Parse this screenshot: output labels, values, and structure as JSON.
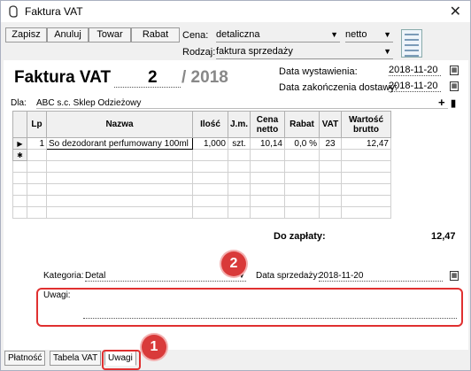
{
  "window": {
    "title": "Faktura VAT",
    "close_glyph": "✕"
  },
  "toolbar": {
    "save": "Zapisz",
    "cancel": "Anuluj",
    "goods": "Towar",
    "discount": "Rabat",
    "price_label": "Cena:",
    "price_value": "detaliczna",
    "netto_value": "netto",
    "type_label": "Rodzaj:",
    "type_value": "faktura sprzedaży"
  },
  "invoice": {
    "title": "Faktura VAT",
    "number": "2",
    "year": "/ 2018",
    "issue_label": "Data wystawienia:",
    "issue_date": "2018-11-20",
    "delivery_label": "Data zakończenia dostawy:",
    "delivery_date": "2018-11-20",
    "for_label": "Dla:",
    "customer": "ABC s.c. Sklep Odzieżowy",
    "plus": "+",
    "minus": "▮"
  },
  "table": {
    "headers": [
      "Lp",
      "Nazwa",
      "Ilość",
      "J.m.",
      "Cena netto",
      "Rabat",
      "VAT",
      "Wartość brutto"
    ],
    "rows": [
      {
        "marker": "▶",
        "lp": "1",
        "name": "So dezodorant perfumowany 100ml",
        "qty": "1,000",
        "unit": "szt.",
        "price": "10,14",
        "discount": "0,0 %",
        "vat": "23",
        "gross": "12,47"
      }
    ],
    "new_row_marker": "✱"
  },
  "summary": {
    "label": "Do zapłaty:",
    "amount": "12,47"
  },
  "footer": {
    "category_label": "Kategoria:",
    "category_value": "Detal",
    "sale_date_label": "Data sprzedaży:",
    "sale_date": "2018-11-20",
    "notes_label": "Uwagi:"
  },
  "tabs": [
    "Płatność",
    "Tabela VAT",
    "Uwagi"
  ],
  "badges": [
    "1",
    "2"
  ],
  "colors": {
    "highlight": "#e03030",
    "badge": "#d93a3a"
  }
}
